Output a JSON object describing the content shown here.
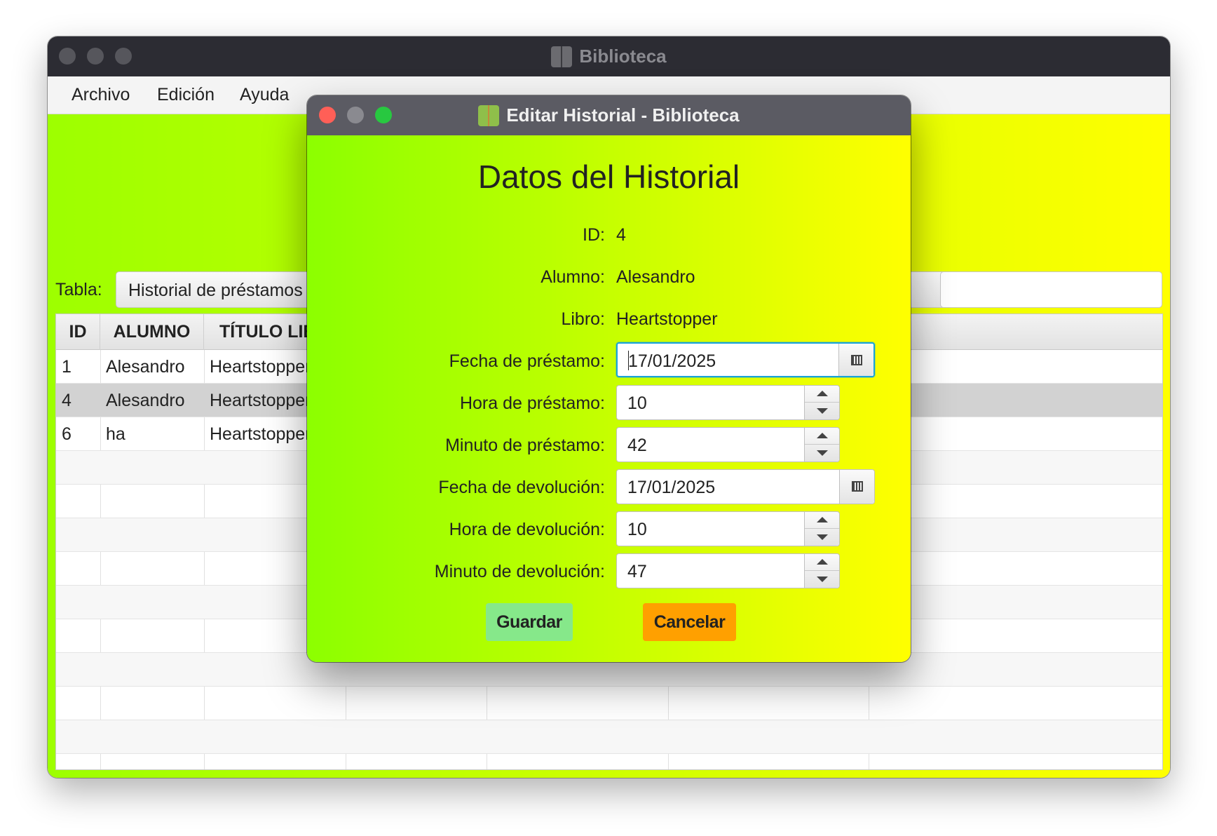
{
  "main_window": {
    "title": "Biblioteca",
    "menu": [
      "Archivo",
      "Edición",
      "Ayuda"
    ],
    "table_label": "Tabla:",
    "table_select_value": "Historial de préstamos",
    "search_value": "",
    "table": {
      "columns": [
        "ID",
        "ALUMNO",
        "TÍTULO LIB"
      ],
      "rows": [
        {
          "id": "1",
          "alumno": "Alesandro",
          "titulo": "Heartstopper"
        },
        {
          "id": "4",
          "alumno": "Alesandro",
          "titulo": "Heartstopper"
        },
        {
          "id": "6",
          "alumno": "ha",
          "titulo": "Heartstopper"
        }
      ],
      "selected_row": 1
    }
  },
  "dialog": {
    "title": "Editar Historial - Biblioteca",
    "heading": "Datos del Historial",
    "fields": {
      "id_label": "ID:",
      "id_value": "4",
      "alumno_label": "Alumno:",
      "alumno_value": "Alesandro",
      "libro_label": "Libro:",
      "libro_value": "Heartstopper",
      "fecha_prestamo_label": "Fecha de préstamo:",
      "fecha_prestamo_value": "17/01/2025",
      "hora_prestamo_label": "Hora de préstamo:",
      "hora_prestamo_value": "10",
      "minuto_prestamo_label": "Minuto de préstamo:",
      "minuto_prestamo_value": "42",
      "fecha_devolucion_label": "Fecha de devolución:",
      "fecha_devolucion_value": "17/01/2025",
      "hora_devolucion_label": "Hora de devolución:",
      "hora_devolucion_value": "10",
      "minuto_devolucion_label": "Minuto de devolución:",
      "minuto_devolucion_value": "47"
    },
    "buttons": {
      "save": "Guardar",
      "cancel": "Cancelar"
    }
  },
  "colors": {
    "background_gradient_start": "#9dff00",
    "background_gradient_end": "#ffff00",
    "save_button": "#86e88a",
    "cancel_button": "#ffa000",
    "focus_ring": "#1aa3d8"
  },
  "icons": [
    "app-book-icon",
    "calendar-icon",
    "spinner-up-icon",
    "spinner-down-icon",
    "dropdown-arrow-icon"
  ]
}
